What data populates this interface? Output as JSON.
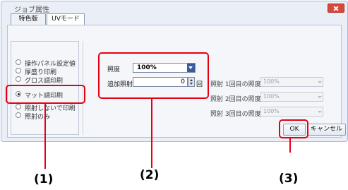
{
  "window": {
    "title": "ジョブ属性"
  },
  "tabs": [
    {
      "label": "特色版"
    },
    {
      "label": "UVモード"
    }
  ],
  "radio_options": [
    {
      "label": "操作パネル設定値",
      "selected": false
    },
    {
      "label": "厚盛り印刷",
      "selected": false
    },
    {
      "label": "グロス調印刷",
      "selected": false
    },
    {
      "label": "マット調印刷",
      "selected": true
    },
    {
      "label": "照射しないで印刷",
      "selected": false
    },
    {
      "label": "照射のみ",
      "selected": false
    }
  ],
  "controls": {
    "illuminance_label": "照度",
    "illuminance_value": "100%",
    "extra_label": "追加照射",
    "extra_value": "0",
    "extra_unit": "回"
  },
  "passes": [
    {
      "label": "照射 1回目の照度",
      "value": "100%"
    },
    {
      "label": "照射 2回目の照度",
      "value": "100%"
    },
    {
      "label": "照射 3回目の照度",
      "value": "100%"
    }
  ],
  "buttons": {
    "ok": "OK",
    "cancel": "キャンセル"
  },
  "callouts": [
    "(1)",
    "(2)",
    "(3)"
  ],
  "colors": {
    "annotation_red": "#e60012",
    "select_arrow": "#3a5aa0"
  }
}
